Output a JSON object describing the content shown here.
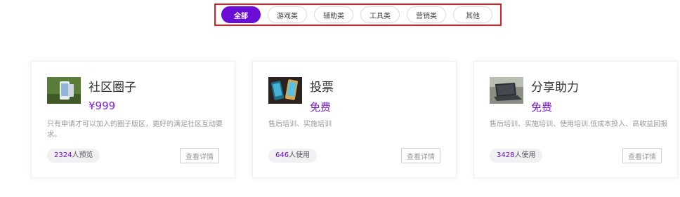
{
  "tabs": [
    {
      "label": "全部",
      "active": true
    },
    {
      "label": "游戏类",
      "active": false
    },
    {
      "label": "辅助类",
      "active": false
    },
    {
      "label": "工具类",
      "active": false
    },
    {
      "label": "营销类",
      "active": false
    },
    {
      "label": "其他",
      "active": false
    }
  ],
  "cards": [
    {
      "title": "社区圈子",
      "price": "¥999",
      "description": "只有申请才可以加入的圈子版区，更好的满足社区互动要求。",
      "count": "2324",
      "count_suffix": "人预览",
      "button": "查看详情"
    },
    {
      "title": "投票",
      "price": "免费",
      "description": "售后培训、实施培训",
      "count": "646",
      "count_suffix": "人使用",
      "button": "查看详情"
    },
    {
      "title": "分享助力",
      "price": "免费",
      "description": "售后培训、实施培训、使用培训.低成本投入、高收益回报",
      "count": "3428",
      "count_suffix": "人使用",
      "button": "查看详情"
    }
  ],
  "colors": {
    "accent": "#6a0dd6",
    "price": "#7d1fd8",
    "highlight_border": "#e31b23"
  }
}
